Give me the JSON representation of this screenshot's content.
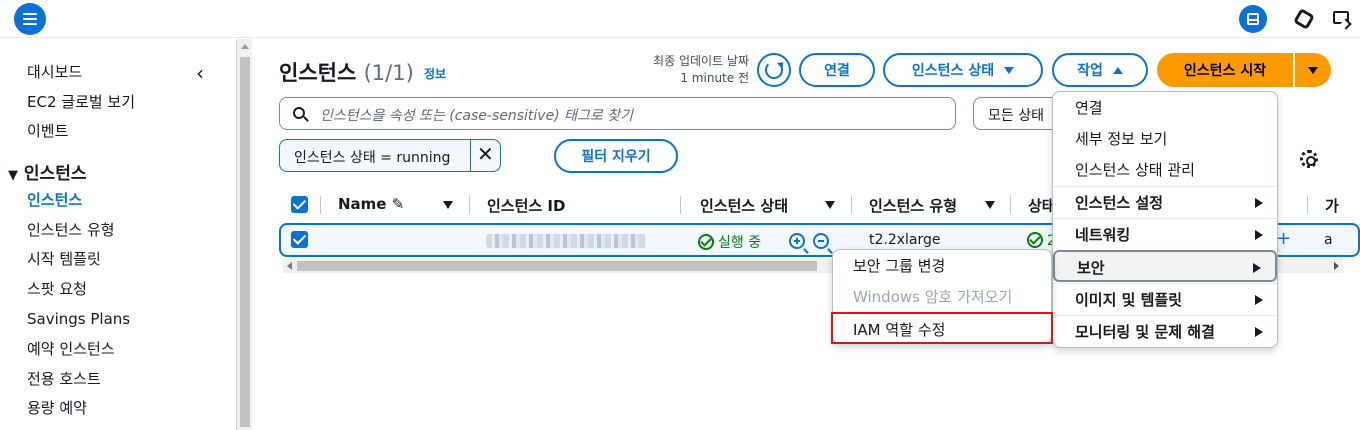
{
  "sidebar": {
    "items": [
      {
        "label": "대시보드"
      },
      {
        "label": "EC2 글로벌 보기"
      },
      {
        "label": "이벤트"
      },
      {
        "label": "인스턴스"
      },
      {
        "label": "인스턴스 유형"
      },
      {
        "label": "시작 템플릿"
      },
      {
        "label": "스팟 요청"
      },
      {
        "label": "Savings Plans"
      },
      {
        "label": "예약 인스턴스"
      },
      {
        "label": "전용 호스트"
      },
      {
        "label": "용량 예약"
      }
    ],
    "section_label": "인스턴스",
    "section_glyph": "▼",
    "collapse_glyph": "‹"
  },
  "header": {
    "title": "인스턴스",
    "count": "(1/1)",
    "info_link": "정보",
    "updated_line1": "최종 업데이트 날짜",
    "updated_line2": "1 minute 전",
    "connect_label": "연결",
    "instance_state_label": "인스턴스 상태",
    "actions_label": "작업",
    "launch_label": "인스턴스 시작"
  },
  "search": {
    "placeholder": "인스턴스을 속성 또는 (case-sensitive) 태그로 찾기",
    "state_select_value": "모든 상태"
  },
  "filter": {
    "token_text": "인스턴스 상태 = running",
    "remove_glyph": "✕",
    "clear_label": "필터 지우기"
  },
  "table": {
    "columns": [
      "Name",
      "인스턴스 ID",
      "인스턴스 상태",
      "인스턴스 유형",
      "상태"
    ],
    "row": {
      "status": "실행 중",
      "type": "t2.2xlarge",
      "partial_status": "2",
      "partial_col": "a",
      "partial_col_head": "가"
    },
    "name_edit_glyph": "✎",
    "row_plus_glyph": "+"
  },
  "actions_menu": {
    "items": [
      {
        "label": "연결",
        "group": false
      },
      {
        "label": "세부 정보 보기",
        "group": false
      },
      {
        "label": "인스턴스 상태 관리",
        "group": false
      },
      {
        "label": "인스턴스 설정",
        "group": true
      },
      {
        "label": "네트워킹",
        "group": true
      },
      {
        "label": "보안",
        "group": true
      },
      {
        "label": "이미지 및 템플릿",
        "group": true
      },
      {
        "label": "모니터링 및 문제 해결",
        "group": true
      }
    ]
  },
  "security_submenu": {
    "items": [
      {
        "label": "보안 그룹 변경"
      },
      {
        "label": "Windows 암호 가져오기"
      },
      {
        "label": "IAM 역할 수정"
      }
    ]
  },
  "colors": {
    "accent": "#0972d3",
    "primary": "#ff9900",
    "running": "#037f0c",
    "highlight": "#d91515"
  }
}
